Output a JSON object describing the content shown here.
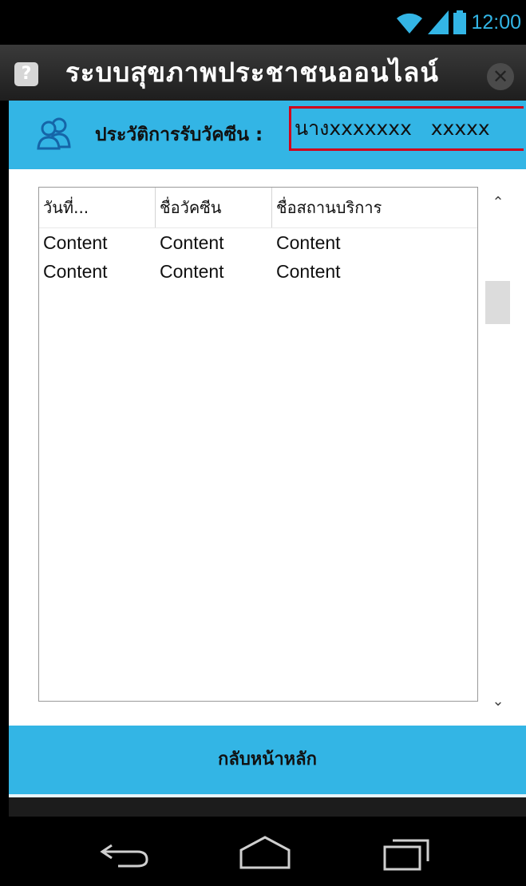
{
  "status_bar": {
    "time": "12:00",
    "icons": [
      "wifi-icon",
      "signal-icon",
      "battery-icon"
    ],
    "accent_color": "#33b5e5"
  },
  "title_bar": {
    "help_icon_glyph": "?",
    "title": "ระบบสุขภาพประชาชนออนไลน์",
    "close_icon_glyph": "✕"
  },
  "header": {
    "icon": "users-icon",
    "label": "ประวัติการรับวัคซีน :",
    "patient_name": "นางxxxxxxx   xxxxx",
    "highlight_color": "#d0021b"
  },
  "table": {
    "columns": [
      "วันที่...",
      "ชื่อวัคซีน",
      "ชื่อสถานบริการ"
    ],
    "rows": [
      [
        "Content",
        "Content",
        "Content"
      ],
      [
        "Content",
        "Content",
        "Content"
      ]
    ],
    "scroll_up_glyph": "⌃",
    "scroll_down_glyph": "⌄"
  },
  "footer": {
    "back_home_label": "กลับหน้าหลัก"
  },
  "nav_bar": {
    "items": [
      "back-icon",
      "home-icon",
      "recent-apps-icon"
    ]
  },
  "colors": {
    "primary": "#33b5e5",
    "title_bar": "#2a2a2a"
  }
}
